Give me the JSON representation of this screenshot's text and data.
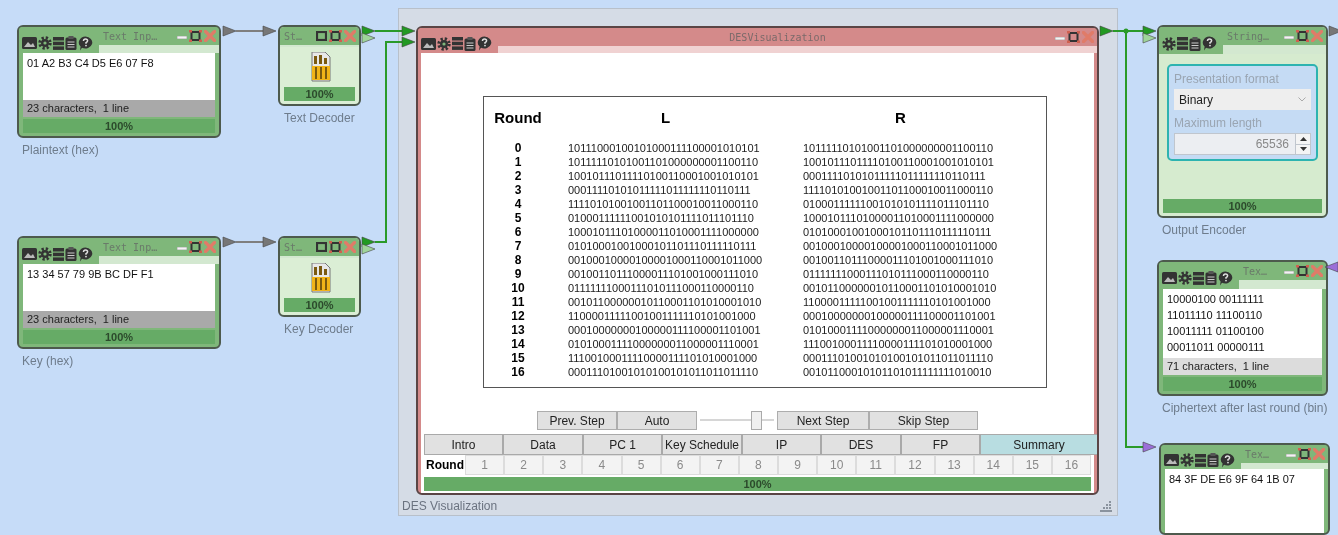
{
  "workspace": {
    "panel": {
      "caption": "DES Visualization"
    },
    "nodes": [
      {
        "kind": "text_input",
        "title": "Text Inp…",
        "text": [
          "01 A2 B3 C4 D5 E6 07 F8"
        ],
        "status": "23 characters,  1 line",
        "progress": {
          "label": "100%",
          "level": 1
        },
        "caption": "Plaintext (hex)"
      },
      {
        "kind": "decoder",
        "title": "St…",
        "progress": {
          "label": "100%",
          "level": 1
        },
        "caption": "Text Decoder"
      },
      {
        "kind": "text_input",
        "title": "Text Inp…",
        "text": [
          "13 34 57 79 9B BC DF F1"
        ],
        "status": "23 characters,  1 line",
        "progress": {
          "label": "100%",
          "level": 1
        },
        "caption": "Key (hex)"
      },
      {
        "kind": "decoder",
        "title": "St…",
        "progress": {
          "label": "100%",
          "level": 1
        },
        "caption": "Key Decoder"
      },
      {
        "kind": "visualization",
        "title": "DESVisualization",
        "table": {
          "columns": [
            "Round",
            "L",
            "R"
          ],
          "rows": [
            {
              "round": "0",
              "l": "10111000100101000111100001010101",
              "r": "10111110101001101000000001100110"
            },
            {
              "round": "1",
              "l": "10111110101001101000000001100110",
              "r": "10010111011110100110001001010101"
            },
            {
              "round": "2",
              "l": "10010111011110100110001001010101",
              "r": "00011110101011111011111110110111"
            },
            {
              "round": "3",
              "l": "00011110101011111011111110110111",
              "r": "11110101001001101100010011000110"
            },
            {
              "round": "4",
              "l": "11110101001001101100010011000110",
              "r": "01000111111001010101111011101110"
            },
            {
              "round": "5",
              "l": "01000111111001010101111011101110",
              "r": "10001011101000011010001111000000"
            },
            {
              "round": "6",
              "l": "10001011101000011010001111000000",
              "r": "01010001001000101101110111110111"
            },
            {
              "round": "7",
              "l": "01010001001000101101110111110111",
              "r": "00100010000100001000110001011000"
            },
            {
              "round": "8",
              "l": "00100010000100001000110001011000",
              "r": "00100110111000011101001000111010"
            },
            {
              "round": "9",
              "l": "00100110111000011101001000111010",
              "r": "01111111000111010111000110000110"
            },
            {
              "round": "10",
              "l": "01111111000111010111000110000110",
              "r": "00101100000010110001101010001010"
            },
            {
              "round": "11",
              "l": "00101100000010110001101010001010",
              "r": "11000011111001001111110101001000"
            },
            {
              "round": "12",
              "l": "11000011111001001111110101001000",
              "r": "00010000000100000111100001101001"
            },
            {
              "round": "13",
              "l": "00010000000100000111100001101001",
              "r": "01010001111000000011000001110001"
            },
            {
              "round": "14",
              "l": "01010001111000000011000001110001",
              "r": "11100100011110000111101010001000"
            },
            {
              "round": "15",
              "l": "11100100011110000111101010001000",
              "r": "00011101001010100101011011011110"
            },
            {
              "round": "16",
              "l": "00011101001010100101011011011110",
              "r": "00101100010101101011111111010010"
            }
          ]
        },
        "buttons": [
          "Prev. Step",
          "Auto",
          "Next Step",
          "Skip Step"
        ],
        "speed_slider": {
          "level": 0.76
        },
        "tabs": [
          {
            "label": "Intro",
            "selected": false
          },
          {
            "label": "Data",
            "selected": false
          },
          {
            "label": "PC 1",
            "selected": false
          },
          {
            "label": "Key Schedule",
            "selected": false
          },
          {
            "label": "IP",
            "selected": false
          },
          {
            "label": "DES",
            "selected": false
          },
          {
            "label": "FP",
            "selected": false
          },
          {
            "label": "Summary",
            "selected": true
          }
        ],
        "round_row": {
          "label": "Round",
          "rounds": [
            "1",
            "2",
            "3",
            "4",
            "5",
            "6",
            "7",
            "8",
            "9",
            "10",
            "11",
            "12",
            "13",
            "14",
            "15",
            "16"
          ]
        },
        "progress": {
          "label": "100%",
          "level": 1
        }
      },
      {
        "kind": "encoder",
        "title": "String…",
        "settings": [
          {
            "kind": "dropdown",
            "label": "Presentation format",
            "value": "Binary",
            "disabled": true
          },
          {
            "kind": "spinner",
            "label": "Maximum length",
            "value": "65536",
            "disabled": true
          }
        ],
        "progress": {
          "label": "100%",
          "level": 1
        },
        "caption": "Output Encoder"
      },
      {
        "kind": "text_output",
        "title": "Tex…",
        "text": [
          "10000100 00111111",
          "11011110 11100110",
          "10011111 01100100",
          "00011011 00000111"
        ],
        "status": "71 characters,  1 line",
        "progress": {
          "label": "100%",
          "level": 1
        },
        "caption": "Ciphertext after last round (bin)"
      },
      {
        "kind": "text_output",
        "title": "Tex…",
        "text": [
          "84 3F DE E6 9F 64 1B 07"
        ]
      }
    ]
  }
}
